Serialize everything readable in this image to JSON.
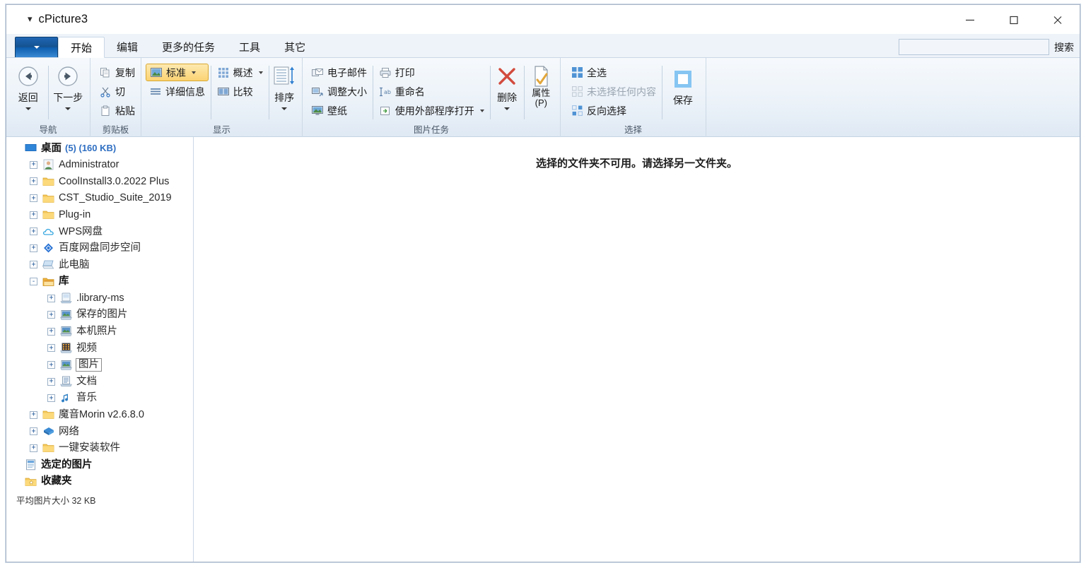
{
  "window": {
    "title": "cPicture3",
    "controls": {
      "minimize": "minimize-icon",
      "maximize": "maximize-icon",
      "close": "close-icon"
    }
  },
  "tabstrip": {
    "app_button": "app-menu-button",
    "tabs": [
      {
        "label": "开始",
        "active": true
      },
      {
        "label": "编辑",
        "active": false
      },
      {
        "label": "更多的任务",
        "active": false
      },
      {
        "label": "工具",
        "active": false
      },
      {
        "label": "其它",
        "active": false
      }
    ],
    "search": {
      "value": "",
      "placeholder": "",
      "label": "搜索"
    }
  },
  "ribbon": {
    "groups": [
      {
        "label": "导航",
        "big_buttons": [
          {
            "label": "返回",
            "icon": "arrow-left-circle-icon",
            "has_caret": true
          },
          {
            "label": "下一步",
            "icon": "arrow-right-circle-icon",
            "has_caret": true
          }
        ]
      },
      {
        "label": "剪贴板",
        "small_buttons": [
          {
            "label": "复制",
            "icon": "copy-icon"
          },
          {
            "label": "切",
            "icon": "scissors-icon"
          },
          {
            "label": "粘贴",
            "icon": "clipboard-icon"
          }
        ]
      },
      {
        "label": "显示",
        "columns": [
          [
            {
              "label": "标准",
              "icon": "picture-icon",
              "selected": true,
              "has_caret": true
            },
            {
              "label": "详细信息",
              "icon": "list-lines-icon"
            }
          ],
          [
            {
              "label": "概述",
              "icon": "grid-icon",
              "has_caret": true
            },
            {
              "label": "比较",
              "icon": "compare-icon"
            }
          ]
        ],
        "big_buttons": [
          {
            "label": "排序",
            "icon": "sort-icon",
            "has_caret": true
          }
        ]
      },
      {
        "label": "图片任务",
        "columns": [
          [
            {
              "label": "电子邮件",
              "icon": "email-icon"
            },
            {
              "label": "调整大小",
              "icon": "resize-icon"
            },
            {
              "label": "壁纸",
              "icon": "wallpaper-icon"
            }
          ],
          [
            {
              "label": "打印",
              "icon": "printer-icon"
            },
            {
              "label": "重命名",
              "icon": "rename-icon"
            },
            {
              "label": "使用外部程序打开",
              "icon": "open-external-icon",
              "has_caret": true
            }
          ]
        ],
        "big_buttons": [
          {
            "label": "删除",
            "icon": "delete-x-icon",
            "has_caret": true
          },
          {
            "label": "属性",
            "label2": "(P)",
            "icon": "properties-icon",
            "has_caret": false
          }
        ]
      },
      {
        "label": "选择",
        "small_buttons": [
          {
            "label": "全选",
            "icon": "select-all-icon"
          },
          {
            "label": "未选择任何内容",
            "icon": "select-none-icon",
            "disabled": true
          },
          {
            "label": "反向选择",
            "icon": "invert-selection-icon"
          }
        ],
        "big_buttons": [
          {
            "label": "保存",
            "icon": "save-square-icon"
          }
        ]
      }
    ]
  },
  "sidebar": {
    "tree": [
      {
        "label": "桌面",
        "meta": "(5) (160 KB)",
        "icon": "desktop-icon",
        "indent": 0,
        "expander": "none",
        "bold": true
      },
      {
        "label": "Administrator",
        "icon": "user-icon",
        "indent": 1,
        "expander": "+"
      },
      {
        "label": "CoolInstall3.0.2022 Plus",
        "icon": "folder-icon",
        "indent": 1,
        "expander": "+"
      },
      {
        "label": "CST_Studio_Suite_2019",
        "icon": "folder-icon",
        "indent": 1,
        "expander": "+"
      },
      {
        "label": "Plug-in",
        "icon": "folder-icon",
        "indent": 1,
        "expander": "+"
      },
      {
        "label": "WPS网盘",
        "icon": "cloud-icon",
        "indent": 1,
        "expander": "+"
      },
      {
        "label": "百度网盘同步空间",
        "icon": "baidu-diamond-icon",
        "indent": 1,
        "expander": "+"
      },
      {
        "label": "此电脑",
        "icon": "computer-icon",
        "indent": 1,
        "expander": "+"
      },
      {
        "label": "库",
        "icon": "library-folder-icon",
        "indent": 1,
        "expander": "-",
        "bold": true
      },
      {
        "label": ".library-ms",
        "icon": "library-file-icon",
        "indent": 2,
        "expander": "+"
      },
      {
        "label": "保存的图片",
        "icon": "library-pictures-icon",
        "indent": 2,
        "expander": "+"
      },
      {
        "label": "本机照片",
        "icon": "library-pictures-icon",
        "indent": 2,
        "expander": "+"
      },
      {
        "label": "视频",
        "icon": "library-videos-icon",
        "indent": 2,
        "expander": "+"
      },
      {
        "label": "图片",
        "icon": "library-pictures-icon",
        "indent": 2,
        "expander": "+",
        "focused": true
      },
      {
        "label": "文档",
        "icon": "library-documents-icon",
        "indent": 2,
        "expander": "+"
      },
      {
        "label": "音乐",
        "icon": "library-music-icon",
        "indent": 2,
        "expander": "+"
      },
      {
        "label": "魔音Morin v2.6.8.0",
        "icon": "folder-icon",
        "indent": 1,
        "expander": "+"
      },
      {
        "label": "网络",
        "icon": "network-icon",
        "indent": 1,
        "expander": "+"
      },
      {
        "label": "一键安装软件",
        "icon": "folder-icon",
        "indent": 1,
        "expander": "+"
      },
      {
        "label": "选定的图片",
        "icon": "selected-pictures-icon",
        "indent": 0,
        "expander": "none",
        "bold": true
      },
      {
        "label": "收藏夹",
        "icon": "favorites-icon",
        "indent": 0,
        "expander": "none",
        "bold": true
      }
    ],
    "footer": "平均图片大小 32 KB"
  },
  "content": {
    "empty_message": "选择的文件夹不可用。请选择另一文件夹。"
  },
  "colors": {
    "accent": "#2f6fc2",
    "ribbon_bg": "#eaf1f8",
    "selected_highlight": "#fbd373",
    "tab_active_bg": "#ffffff"
  }
}
